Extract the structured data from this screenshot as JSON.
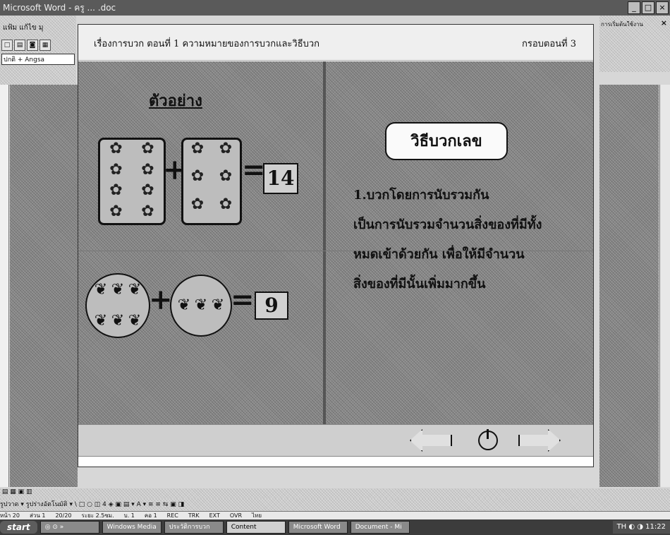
{
  "window": {
    "title": "Microsoft Word - ครู ... .doc",
    "controls": [
      "_",
      "□",
      "×"
    ]
  },
  "word_chrome": {
    "menu_fragment": "แฟ้ม แก้ไข มุ",
    "font_box": "ปกติ + Angsa",
    "pane_title": "การเริ่มต้นใช้งาน",
    "pane_close": "×"
  },
  "lesson": {
    "title": "เรื่องการบวก  ตอนที่ 1 ความหมายของการบวกและวิธีบวก",
    "frame_no": "กรอบตอนที่ 3",
    "example_heading": "ตัวอย่าง",
    "row1": {
      "left_items": 8,
      "right_items": 6,
      "symbol": "✿",
      "plus": "+",
      "equals": "=",
      "result": "14"
    },
    "row2": {
      "left_items": 6,
      "right_items": 3,
      "symbol": "❦",
      "plus": "+",
      "equals": "=",
      "result": "9"
    },
    "method_title": "วิธีบวกเลข",
    "method_lines": [
      "1.บวกโดยการนับรวมกัน",
      "เป็นการนับรวมจำนวนสิ่งของที่มีทั้ง",
      "หมดเข้าด้วยกัน  เพื่อให้มีจำนวน",
      "สิ่งของที่มีนั้นเพิ่มมากขึ้น"
    ],
    "nav": {
      "back": "back-arrow",
      "exit": "power",
      "forward": "forward-arrow"
    }
  },
  "drawing_toolbar": {
    "label": "รูปวาด ▾   รูปร่างอัตโนมัติ ▾   \\  □ ○ ◫ 4 ◈ ▣ ▤  ▾ A ▾ ≡ ≡ ⇆ ▣ ◨"
  },
  "status_bar": {
    "items": [
      "หน้า 20",
      "ส่วน 1",
      "20/20",
      "ระยะ 2.5ซม.",
      "บ. 1",
      "คอ 1",
      "REC",
      "TRK",
      "EXT",
      "OVR",
      "ไทย"
    ]
  },
  "taskbar": {
    "start": "start",
    "tasks": [
      {
        "label": "◎ ⊙ »",
        "active": false
      },
      {
        "label": "Windows Media",
        "active": false
      },
      {
        "label": "ประวัติการบวก",
        "active": false
      },
      {
        "label": "Content",
        "active": true
      },
      {
        "label": "Microsoft Word",
        "active": false
      },
      {
        "label": "Document - Mi",
        "active": false
      }
    ],
    "tray": "TH  ◐ ◑  11:22"
  }
}
